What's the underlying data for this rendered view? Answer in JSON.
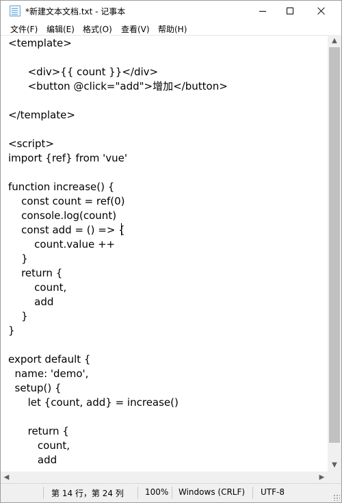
{
  "window": {
    "title": "*新建文本文档.txt - 记事本",
    "controls": {
      "minimize": "—",
      "maximize": "☐",
      "close": "✕"
    }
  },
  "menu": [
    "文件(F)",
    "编辑(E)",
    "格式(O)",
    "查看(V)",
    "帮助(H)"
  ],
  "code_lines": [
    "<template>",
    "",
    "      <div>{{ count }}</div>",
    "      <button @click=\"add\">增加</button>",
    "",
    "</template>",
    "",
    "<script>",
    "import {ref} from 'vue'",
    "",
    "function increase() {",
    "    const count = ref(0)",
    "    console.log(count)",
    "    const add = () => {",
    "        count.value ++",
    "    }",
    "    return {",
    "        count,",
    "        add",
    "    }",
    "}",
    "",
    "export default {",
    "  name: 'demo',",
    "  setup() {",
    "      let {count, add} = increase()",
    "",
    "      return {",
    "         count,",
    "         add"
  ],
  "status": {
    "position": "第 14 行，第 24 列",
    "zoom": "100%",
    "line_ending": "Windows (CRLF)",
    "encoding": "UTF-8"
  }
}
